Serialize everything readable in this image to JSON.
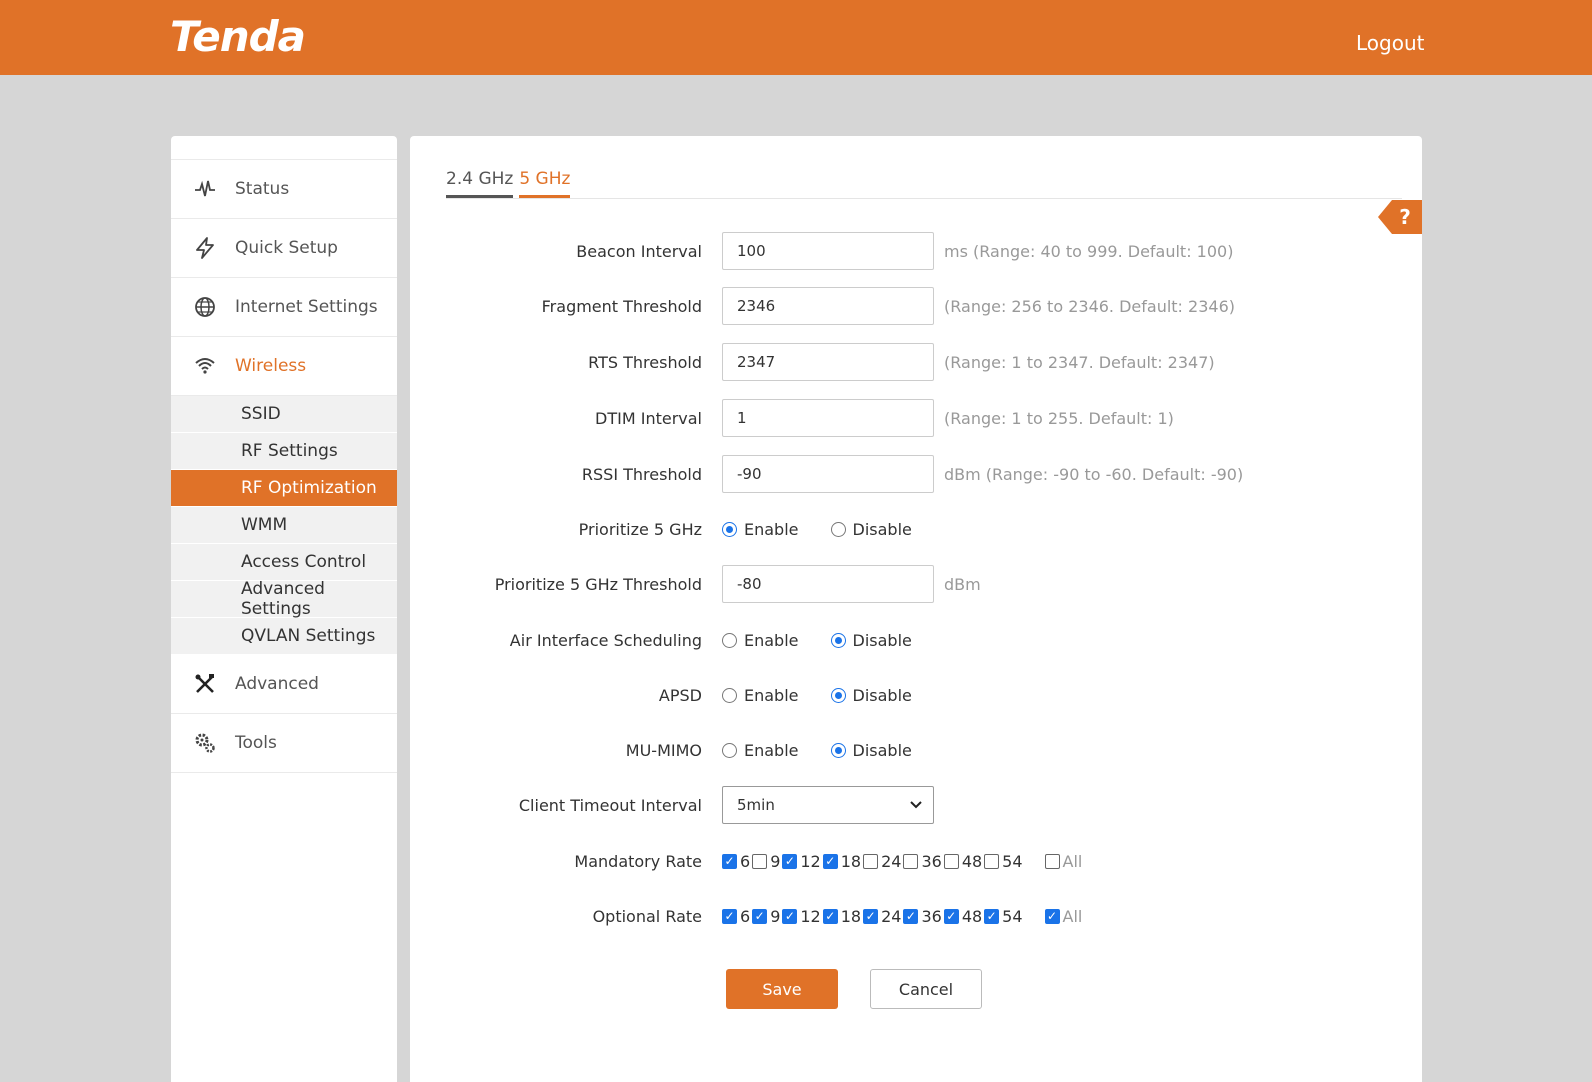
{
  "header": {
    "logo": "Tenda",
    "logout": "Logout"
  },
  "sidebar": {
    "items": [
      {
        "label": "Status",
        "icon": "activity-icon"
      },
      {
        "label": "Quick Setup",
        "icon": "lightning-icon"
      },
      {
        "label": "Internet Settings",
        "icon": "globe-icon"
      },
      {
        "label": "Wireless",
        "icon": "wifi-icon"
      },
      {
        "label": "Advanced",
        "icon": "tools-icon"
      },
      {
        "label": "Tools",
        "icon": "gears-icon"
      }
    ],
    "wireless_sub": [
      "SSID",
      "RF Settings",
      "RF Optimization",
      "WMM",
      "Access Control",
      "Advanced Settings",
      "QVLAN Settings"
    ]
  },
  "tabs": {
    "band24": "2.4 GHz",
    "band5": "5 GHz"
  },
  "help": "?",
  "form": {
    "beacon": {
      "label": "Beacon Interval",
      "value": "100",
      "hint": "ms (Range: 40 to 999. Default: 100)"
    },
    "fragment": {
      "label": "Fragment Threshold",
      "value": "2346",
      "hint": "(Range: 256 to 2346. Default: 2346)"
    },
    "rts": {
      "label": "RTS Threshold",
      "value": "2347",
      "hint": "(Range: 1 to 2347. Default: 2347)"
    },
    "dtim": {
      "label": "DTIM Interval",
      "value": "1",
      "hint": "(Range: 1 to 255. Default: 1)"
    },
    "rssi": {
      "label": "RSSI Threshold",
      "value": "-90",
      "hint": "dBm (Range: -90 to -60. Default: -90)"
    },
    "prioritize": {
      "label": "Prioritize 5 GHz",
      "enable": "Enable",
      "disable": "Disable",
      "selected": "Enable"
    },
    "prioritize_threshold": {
      "label": "Prioritize 5 GHz Threshold",
      "value": "-80",
      "hint": "dBm"
    },
    "air": {
      "label": "Air Interface Scheduling",
      "enable": "Enable",
      "disable": "Disable",
      "selected": "Disable"
    },
    "apsd": {
      "label": "APSD",
      "enable": "Enable",
      "disable": "Disable",
      "selected": "Disable"
    },
    "mumimo": {
      "label": "MU-MIMO",
      "enable": "Enable",
      "disable": "Disable",
      "selected": "Disable"
    },
    "timeout": {
      "label": "Client Timeout Interval",
      "value": "5min"
    },
    "mandatory": {
      "label": "Mandatory Rate",
      "rates": [
        "6",
        "9",
        "12",
        "18",
        "24",
        "36",
        "48",
        "54"
      ],
      "checked": [
        true,
        false,
        true,
        true,
        false,
        false,
        false,
        false
      ],
      "all_label": "All",
      "all_checked": false
    },
    "optional": {
      "label": "Optional Rate",
      "rates": [
        "6",
        "9",
        "12",
        "18",
        "24",
        "36",
        "48",
        "54"
      ],
      "checked": [
        true,
        true,
        true,
        true,
        true,
        true,
        true,
        true
      ],
      "all_label": "All",
      "all_checked": true
    }
  },
  "buttons": {
    "save": "Save",
    "cancel": "Cancel"
  },
  "colors": {
    "accent": "#e07228",
    "check": "#1a73e8"
  }
}
